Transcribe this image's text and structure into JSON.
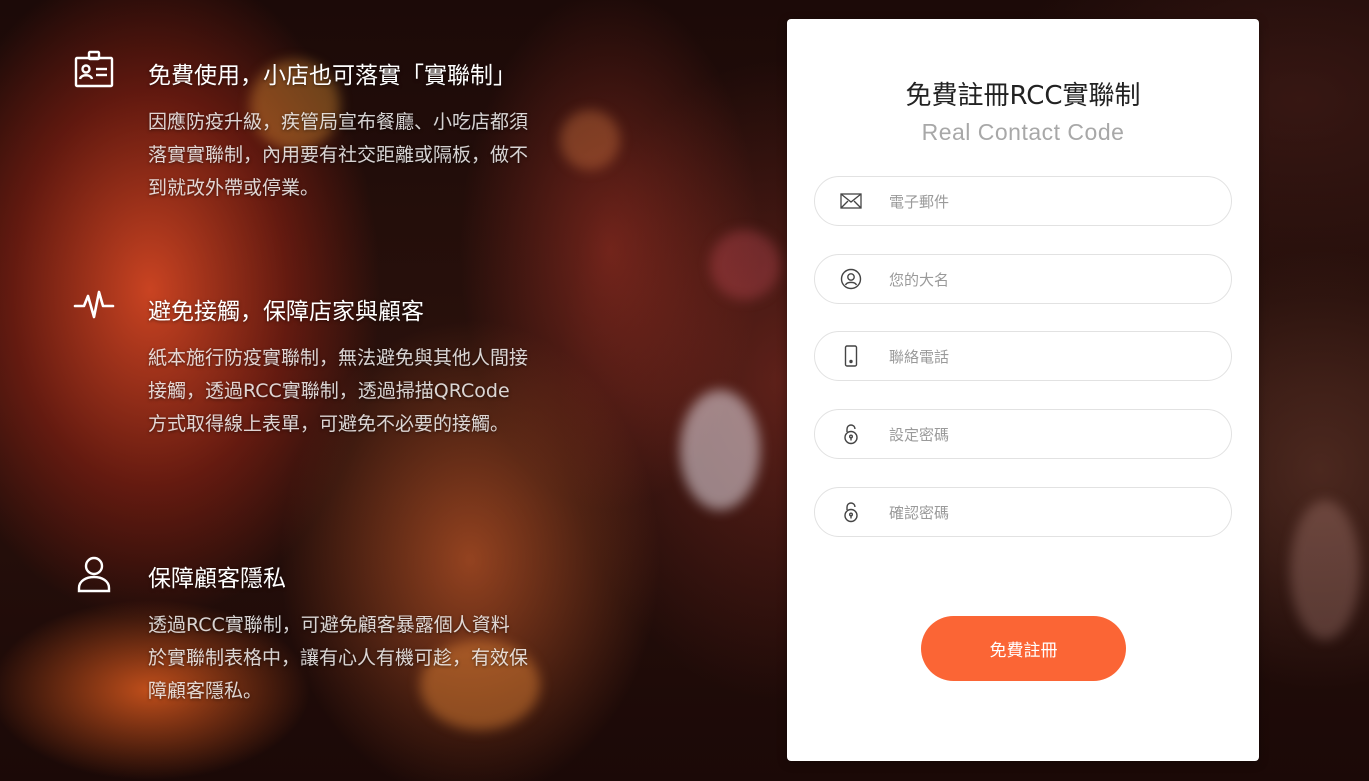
{
  "features": [
    {
      "icon": "id-card-icon",
      "title": "免費使用，小店也可落實「實聯制」",
      "body": "因應防疫升級，疾管局宣布餐廳、小吃店都須落實實聯制，內用要有社交距離或隔板，做不到就改外帶或停業。"
    },
    {
      "icon": "heartbeat-icon",
      "title": "避免接觸，保障店家與顧客",
      "body": "紙本施行防疫實聯制，無法避免與其他人間接接觸，透過RCC實聯制，透過掃描QRCode方式取得線上表單，可避免不必要的接觸。"
    },
    {
      "icon": "user-icon",
      "title": "保障顧客隱私",
      "body": "透過RCC實聯制，可避免顧客暴露個人資料於實聯制表格中，讓有心人有機可趁，有效保障顧客隱私。"
    }
  ],
  "form": {
    "title": "免費註冊RCC實聯制",
    "subtitle": "Real Contact Code",
    "fields": [
      {
        "icon": "envelope-icon",
        "placeholder": "電子郵件",
        "value": ""
      },
      {
        "icon": "user-circle-icon",
        "placeholder": "您的大名",
        "value": ""
      },
      {
        "icon": "mobile-phone-icon",
        "placeholder": "聯絡電話",
        "value": ""
      },
      {
        "icon": "lock-icon",
        "placeholder": "設定密碼",
        "value": ""
      },
      {
        "icon": "lock-icon",
        "placeholder": "確認密碼",
        "value": ""
      }
    ],
    "submit_label": "免費註冊"
  },
  "colors": {
    "accent": "#fb6535",
    "card_bg": "#ffffff",
    "title_text": "#222222",
    "subtitle_text": "#a8a8a8"
  }
}
